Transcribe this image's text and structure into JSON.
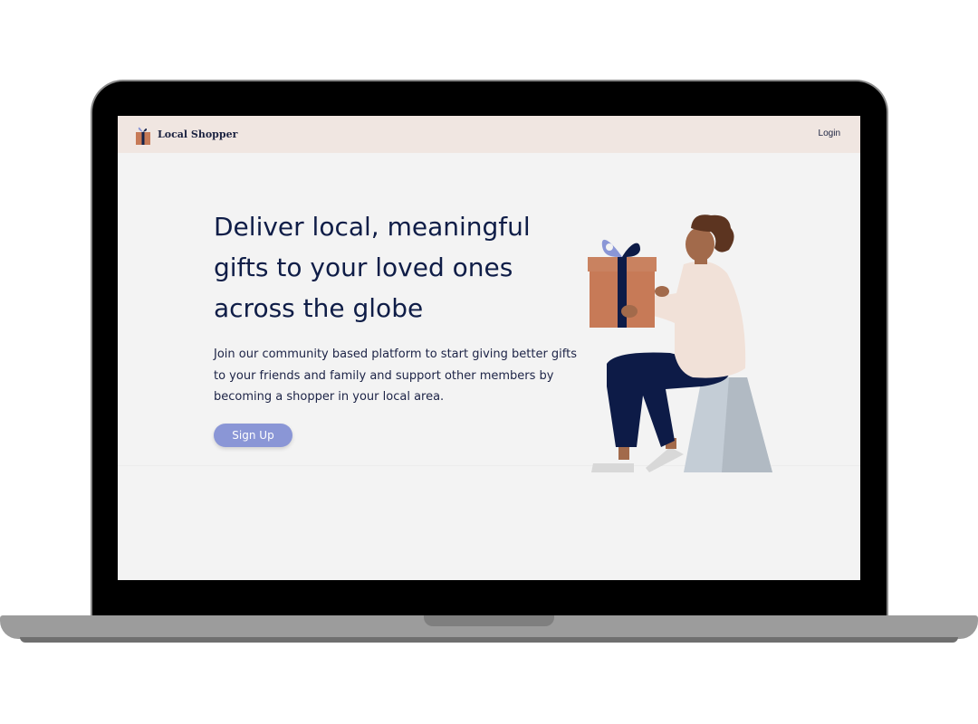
{
  "app": {
    "brand_name": "Local Shopper",
    "nav": {
      "login_label": "Login"
    }
  },
  "hero": {
    "title": "Deliver local, meaningful gifts to your loved ones across the globe",
    "description": "Join our community based platform to start giving better gifts to your friends and family and support other members by becoming a shopper in your local area.",
    "cta_label": "Sign Up"
  },
  "colors": {
    "navbar_bg": "#f0e6e1",
    "page_bg": "#f3f3f3",
    "heading": "#0f1d47",
    "cta": "#8a96d6"
  },
  "icons": {
    "brand_logo": "gift-box-icon",
    "illustration": "person-holding-gift"
  }
}
